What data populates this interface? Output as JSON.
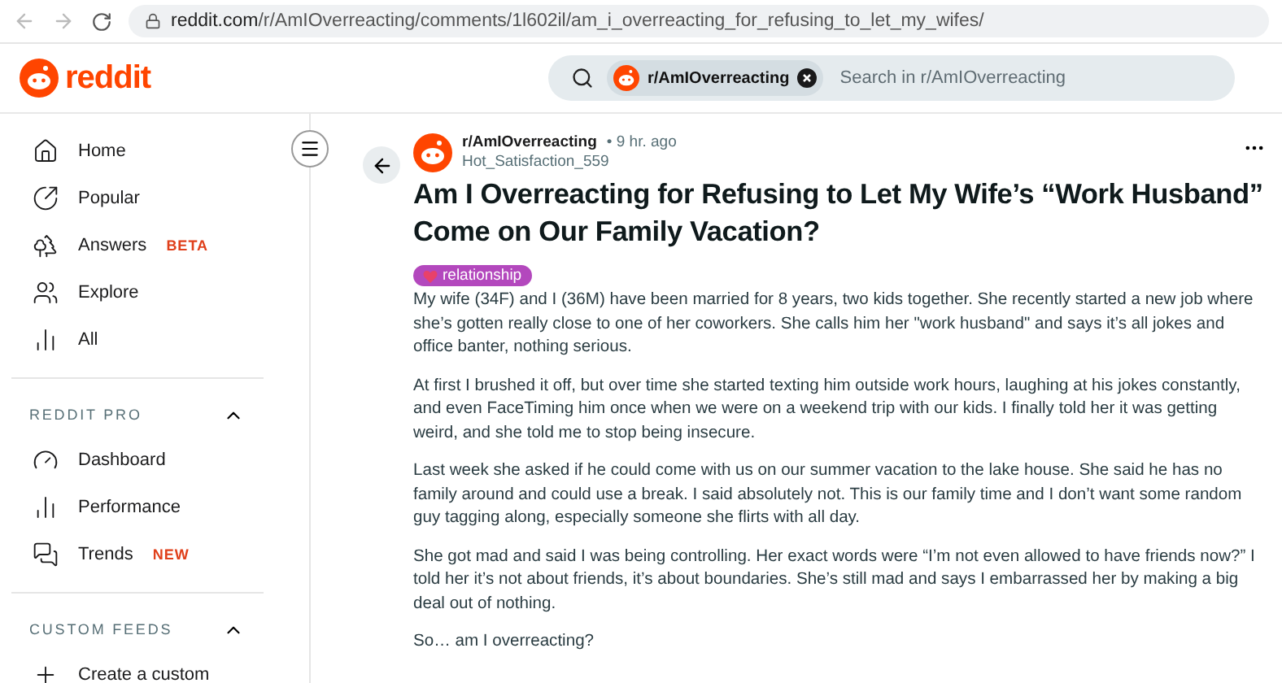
{
  "browser": {
    "url_host": "reddit.com",
    "url_path": "/r/AmIOverreacting/comments/1l602il/am_i_overreacting_for_refusing_to_let_my_wifes/"
  },
  "header": {
    "logo": "reddit",
    "search": {
      "chip": "r/AmIOverreacting",
      "placeholder": "Search in r/AmIOverreacting"
    }
  },
  "sidebar": {
    "items": [
      {
        "kind": "home",
        "label": "Home"
      },
      {
        "kind": "popular",
        "label": "Popular"
      },
      {
        "kind": "answers",
        "label": "Answers",
        "badge": "BETA"
      },
      {
        "kind": "explore",
        "label": "Explore"
      },
      {
        "kind": "all",
        "label": "All"
      }
    ],
    "sections": [
      {
        "title": "REDDIT PRO",
        "expanded": true,
        "items": [
          {
            "kind": "dashboard",
            "label": "Dashboard"
          },
          {
            "kind": "performance",
            "label": "Performance"
          },
          {
            "kind": "trends",
            "label": "Trends",
            "badge": "NEW"
          }
        ]
      },
      {
        "title": "CUSTOM FEEDS",
        "expanded": true,
        "items": [
          {
            "kind": "plus",
            "label": "Create a custom"
          }
        ]
      }
    ]
  },
  "post": {
    "subreddit": "r/AmIOverreacting",
    "age": "• 9 hr. ago",
    "author": "Hot_Satisfaction_559",
    "title": "Am I Overreacting for Refusing to Let My Wife’s “Work Husband” Come on Our Family Vacation?",
    "flair": "relationship",
    "paragraphs": [
      "My wife (34F) and I (36M) have been married for 8 years, two kids together. She recently started a new job where she’s gotten really close to one of her coworkers. She calls him her \"work husband\" and says it’s all jokes and office banter, nothing serious.",
      "At first I brushed it off, but over time she started texting him outside work hours, laughing at his jokes constantly, and even FaceTiming him once when we were on a weekend trip with our kids. I finally told her it was getting weird, and she told me to stop being insecure.",
      "Last week she asked if he could come with us on our summer vacation to the lake house. She said he has no family around and could use a break. I said absolutely not. This is our family time and I don’t want some random guy tagging along, especially someone she flirts with all day.",
      "She got mad and said I was being controlling. Her exact words were “I’m not even allowed to have friends now?” I told her it’s not about friends, it’s about boundaries. She’s still mad and says I embarrassed her by making a big deal out of nothing.",
      "So… am I overreacting?"
    ]
  }
}
